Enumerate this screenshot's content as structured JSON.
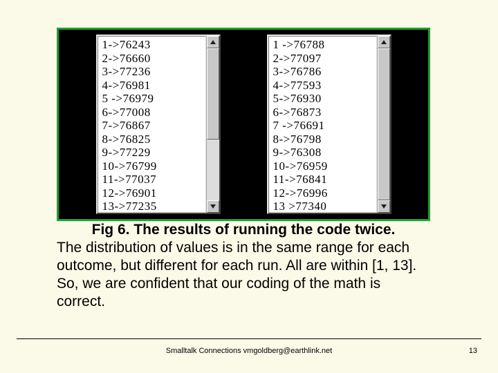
{
  "figure": {
    "run_a": [
      "1->76243",
      "2->76660",
      "3->77236",
      "4->76981",
      "5 ->76979",
      "6->77008",
      "7->76867",
      "8->76825",
      "9->77229",
      "10->76799",
      "11->77037",
      "12->76901",
      "13->77235"
    ],
    "run_b": [
      "1 ->76788",
      "2->77097",
      "3->76786",
      "4->77593",
      "5->76930",
      "6->76873",
      "7 ->76691",
      "8->76798",
      "9->76308",
      "10->76959",
      "11->76841",
      "12->76996",
      "13 >77340"
    ]
  },
  "caption": {
    "title": "Fig 6.  The results of running the code twice.",
    "body": "The distribution of values is in the same range for each outcome, but different for each run.  All are within [1, 13].  So, we are confident that our coding of the math is correct."
  },
  "footer": {
    "text": "Smalltalk Connections  vmgoldberg@earthlink.net",
    "page": "13"
  }
}
